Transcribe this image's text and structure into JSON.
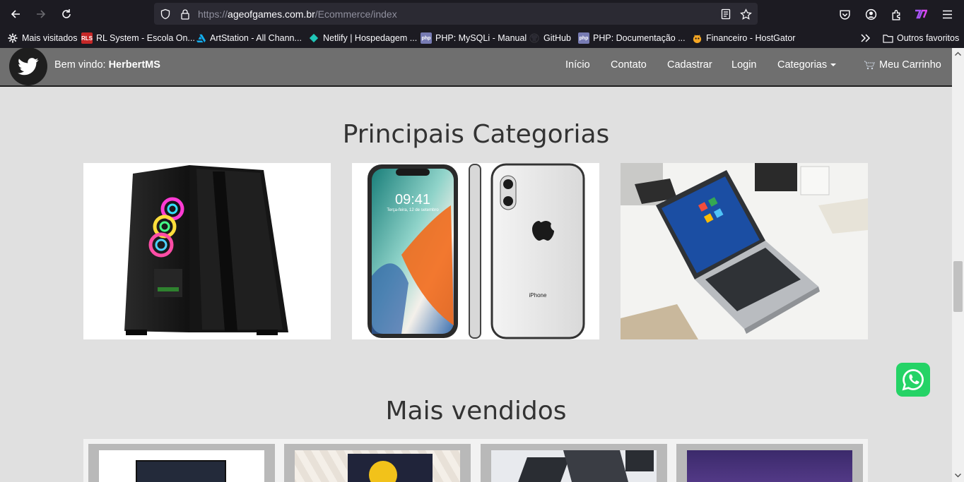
{
  "browser": {
    "url_scheme": "https://",
    "url_domain": "ageofgames.com.br",
    "url_path": "/Ecommerce/index",
    "bookmarks": [
      {
        "label": "Mais visitados",
        "icon": "gear-icon"
      },
      {
        "label": "RL System - Escola On...",
        "icon": "rls-favicon",
        "badge": "RLS"
      },
      {
        "label": "ArtStation - All Chann...",
        "icon": "artstation-favicon"
      },
      {
        "label": "Netlify | Hospedagem ...",
        "icon": "netlify-favicon"
      },
      {
        "label": "PHP: MySQLi - Manual",
        "icon": "php-favicon",
        "badge": "php"
      },
      {
        "label": "GitHub",
        "icon": "github-favicon"
      },
      {
        "label": "PHP: Documentação ...",
        "icon": "php-favicon",
        "badge": "php"
      },
      {
        "label": "Financeiro - HostGator",
        "icon": "hostgator-favicon"
      }
    ],
    "other_bookmarks": "Outros favoritos"
  },
  "site": {
    "welcome_prefix": "Bem vindo: ",
    "username": "HerbertMS",
    "nav": {
      "inicio": "Início",
      "contato": "Contato",
      "cadastrar": "Cadastrar",
      "login": "Login",
      "categorias": "Categorias",
      "carrinho": "Meu Carrinho"
    },
    "categories_title": "Principais Categorias",
    "best_sellers_title": "Mais vendidos",
    "phone_time": "09:41",
    "phone_date": "Terça-feira, 12 de setembro",
    "phone_brand": "iPhone"
  },
  "colors": {
    "navbar": "#6f6f6f",
    "page_bg": "#e0e0e0",
    "whatsapp": "#25d366"
  }
}
